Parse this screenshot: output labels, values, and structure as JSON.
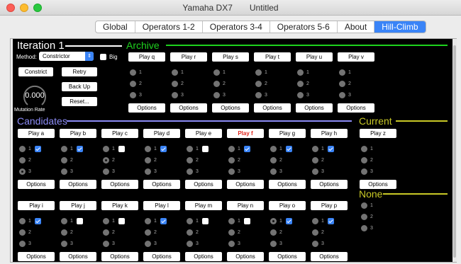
{
  "window": {
    "app_title": "Yamaha DX7",
    "doc_title": "Untitled"
  },
  "tabs": [
    {
      "label": "Global"
    },
    {
      "label": "Operators 1-2"
    },
    {
      "label": "Operators 3-4"
    },
    {
      "label": "Operators 5-6"
    },
    {
      "label": "About"
    },
    {
      "label": "Hill-Climb",
      "active": true
    }
  ],
  "iteration": {
    "label": "Iteration 1"
  },
  "method": {
    "label": "Method:",
    "selected": "Constrictor",
    "big_label": "Big"
  },
  "controls": {
    "constrict": "Constrict",
    "retry": "Retry",
    "back_up": "Back Up",
    "reset": "Reset...",
    "mutation_value": "0.000",
    "mutation_label": "Mutation Rate"
  },
  "sections": {
    "archive": "Archive",
    "candidates": "Candidates",
    "current": "Current",
    "none": "None"
  },
  "colors": {
    "archive": "#1ed21e",
    "candidates": "#8b8bf5",
    "current": "#c8c826",
    "none": "#c8c826",
    "accent": "#3a84f7"
  },
  "options_label": "Options",
  "radio_labels": [
    "1",
    "2",
    "3"
  ],
  "archive": [
    {
      "play": "Play q"
    },
    {
      "play": "Play r"
    },
    {
      "play": "Play s"
    },
    {
      "play": "Play t"
    },
    {
      "play": "Play u"
    },
    {
      "play": "Play v"
    }
  ],
  "candidates_row1": [
    {
      "play": "Play a",
      "checked": true,
      "radio": 3
    },
    {
      "play": "Play b",
      "checked": true,
      "radio": 0
    },
    {
      "play": "Play c",
      "checked": false,
      "radio": 2
    },
    {
      "play": "Play d",
      "checked": true,
      "radio": 0
    },
    {
      "play": "Play e",
      "checked": false,
      "radio": 0
    },
    {
      "play": "Play f",
      "checked": true,
      "radio": 0,
      "highlight": true
    },
    {
      "play": "Play g",
      "checked": true,
      "radio": 0
    },
    {
      "play": "Play h",
      "checked": true,
      "radio": 0
    }
  ],
  "candidates_row2": [
    {
      "play": "Play i",
      "checked": true,
      "radio": 0
    },
    {
      "play": "Play j",
      "checked": false,
      "radio": 0
    },
    {
      "play": "Play k",
      "checked": false,
      "radio": 0
    },
    {
      "play": "Play l",
      "checked": true,
      "radio": 0
    },
    {
      "play": "Play m",
      "checked": false,
      "radio": 0
    },
    {
      "play": "Play n",
      "checked": false,
      "radio": 0
    },
    {
      "play": "Play o",
      "checked": true,
      "radio": 1
    },
    {
      "play": "Play p",
      "checked": true,
      "radio": 0
    }
  ],
  "current": {
    "play": "Play z"
  }
}
